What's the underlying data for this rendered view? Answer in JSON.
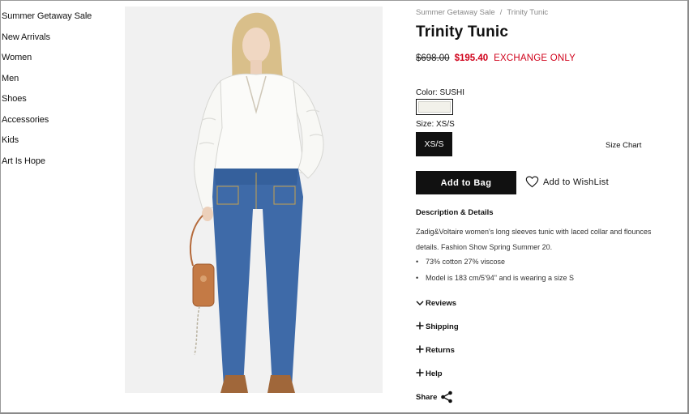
{
  "sidebar": {
    "items": [
      {
        "label": "Summer Getaway Sale"
      },
      {
        "label": "New Arrivals"
      },
      {
        "label": "Women"
      },
      {
        "label": "Men"
      },
      {
        "label": "Shoes"
      },
      {
        "label": "Accessories"
      },
      {
        "label": "Kids"
      },
      {
        "label": "Art Is Hope"
      }
    ]
  },
  "breadcrumb": {
    "parent": "Summer Getaway Sale",
    "separator": "/",
    "current": "Trinity Tunic"
  },
  "product": {
    "title": "Trinity Tunic",
    "price_original": "$698.00",
    "price_sale": "$195.40",
    "exchange_note": "EXCHANGE ONLY",
    "color_label": "Color: SUSHI",
    "swatch_color": "#f2f1ea",
    "size_label": "Size: XS/S",
    "size_option": "XS/S",
    "size_chart": "Size Chart",
    "add_to_bag": "Add to Bag",
    "wishlist": "Add to WishList"
  },
  "description": {
    "title": "Description & Details",
    "text": "Zadig&Voltaire women's long sleeves tunic with laced collar and flounces details. Fashion Show Spring Summer 20.",
    "bullets": [
      {
        "text": "73% cotton 27% viscose"
      },
      {
        "text": "Model is 183 cm/5'94\" and is wearing a size S"
      }
    ]
  },
  "accordion": {
    "reviews": {
      "icon": "chevron-down-icon",
      "label": "Reviews"
    },
    "shipping": {
      "icon": "plus-icon",
      "label": "Shipping"
    },
    "returns": {
      "icon": "plus-icon",
      "label": "Returns"
    },
    "help": {
      "icon": "plus-icon",
      "label": "Help"
    }
  },
  "share": {
    "label": "Share",
    "icon": "share-icon"
  },
  "colors": {
    "sale_red": "#d0021b",
    "button_black": "#111111",
    "breadcrumb_gray": "#8a8a8a"
  }
}
